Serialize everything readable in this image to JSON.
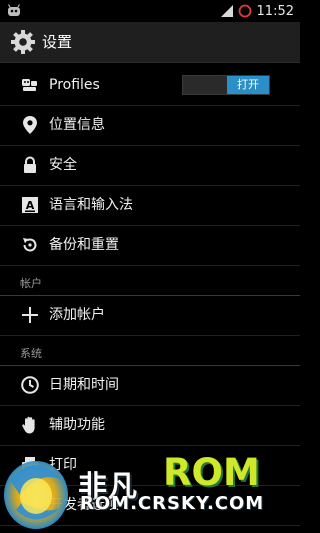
{
  "statusbar": {
    "time": "11:52",
    "left_icon": "android-robot-icon",
    "right_icons": [
      "signal-icon",
      "battery-icon"
    ]
  },
  "actionbar": {
    "title": "设置",
    "icon": "settings-gear-icon"
  },
  "items": [
    {
      "label": "Profiles",
      "icon": "profiles-icon",
      "toggle": "打开"
    },
    {
      "label": "位置信息",
      "icon": "location-pin-icon"
    },
    {
      "label": "安全",
      "icon": "lock-icon"
    },
    {
      "label": "语言和输入法",
      "icon": "keyboard-a-icon"
    },
    {
      "label": "备份和重置",
      "icon": "backup-restore-icon"
    }
  ],
  "sections": [
    {
      "title": "帐户",
      "items": [
        {
          "label": "添加帐户",
          "icon": "plus-icon"
        }
      ]
    },
    {
      "title": "系统",
      "items": [
        {
          "label": "日期和时间",
          "icon": "clock-icon"
        },
        {
          "label": "辅助功能",
          "icon": "hand-icon"
        },
        {
          "label": "打印",
          "icon": "print-icon"
        },
        {
          "label": "开发者选项",
          "icon": "developer-icon"
        }
      ]
    }
  ],
  "watermark": {
    "cn": "非凡",
    "rom": "ROM",
    "url": "ROM.CRSKY.COM"
  },
  "colors": {
    "accent": "#2a8fc7",
    "watermark_green": "#cfe82a"
  }
}
